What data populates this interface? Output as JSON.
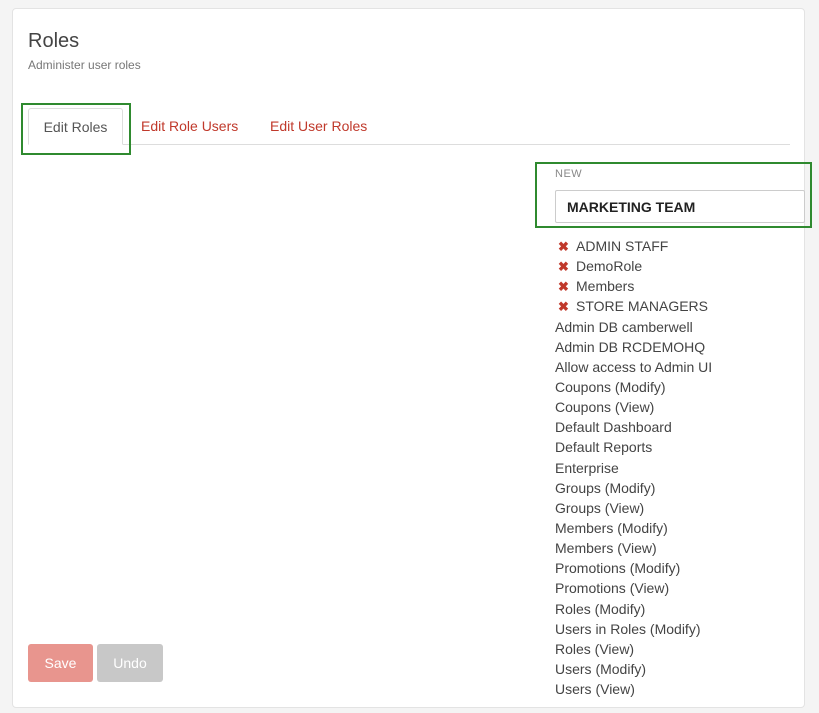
{
  "header": {
    "title": "Roles",
    "subtitle": "Administer user roles"
  },
  "tabs": [
    {
      "label": "Edit Roles",
      "active": true
    },
    {
      "label": "Edit Role Users",
      "active": false
    },
    {
      "label": "Edit User Roles",
      "active": false
    }
  ],
  "new_role": {
    "label": "NEW",
    "value": "MARKETING TEAM"
  },
  "roles": [
    {
      "name": "ADMIN STAFF",
      "deletable": true
    },
    {
      "name": "DemoRole",
      "deletable": true
    },
    {
      "name": "Members",
      "deletable": true
    },
    {
      "name": "STORE MANAGERS",
      "deletable": true
    },
    {
      "name": "Admin DB camberwell",
      "deletable": false
    },
    {
      "name": "Admin DB RCDEMOHQ",
      "deletable": false
    },
    {
      "name": "Allow access to Admin UI",
      "deletable": false
    },
    {
      "name": "Coupons (Modify)",
      "deletable": false
    },
    {
      "name": "Coupons (View)",
      "deletable": false
    },
    {
      "name": "Default Dashboard",
      "deletable": false
    },
    {
      "name": "Default Reports",
      "deletable": false
    },
    {
      "name": "Enterprise",
      "deletable": false
    },
    {
      "name": "Groups (Modify)",
      "deletable": false
    },
    {
      "name": "Groups (View)",
      "deletable": false
    },
    {
      "name": "Members (Modify)",
      "deletable": false
    },
    {
      "name": "Members (View)",
      "deletable": false
    },
    {
      "name": "Promotions (Modify)",
      "deletable": false
    },
    {
      "name": "Promotions (View)",
      "deletable": false
    },
    {
      "name": "Roles (Modify)",
      "deletable": false
    },
    {
      "name": "Users in Roles (Modify)",
      "deletable": false
    },
    {
      "name": "Roles (View)",
      "deletable": false
    },
    {
      "name": "Users (Modify)",
      "deletable": false
    },
    {
      "name": "Users (View)",
      "deletable": false
    }
  ],
  "actions": {
    "save_label": "Save",
    "undo_label": "Undo"
  },
  "colors": {
    "accent": "#c0392b",
    "highlight": "#2f8a2f",
    "save_bg": "#e8958e",
    "undo_bg": "#c8c8c8"
  },
  "icons": {
    "delete": "close-icon"
  }
}
